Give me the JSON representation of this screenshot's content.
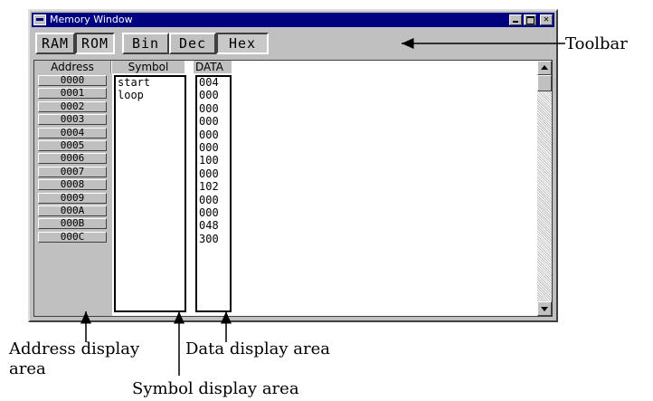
{
  "window": {
    "title": "Memory Window",
    "buttons": [
      "minimize",
      "maximize",
      "close"
    ]
  },
  "toolbar": {
    "buttons": [
      {
        "label": "RAM",
        "pressed": false
      },
      {
        "label": "ROM",
        "pressed": true
      },
      {
        "label": "Bin",
        "pressed": false
      },
      {
        "label": "Dec",
        "pressed": false
      },
      {
        "label": "Hex",
        "pressed": true
      }
    ]
  },
  "columns": {
    "address": "Address",
    "symbol": "Symbol",
    "data": "DATA"
  },
  "rows": [
    {
      "address": "0000",
      "symbol": "start",
      "data": "004"
    },
    {
      "address": "0001",
      "symbol": "loop",
      "data": "000"
    },
    {
      "address": "0002",
      "symbol": "",
      "data": "000"
    },
    {
      "address": "0003",
      "symbol": "",
      "data": "000"
    },
    {
      "address": "0004",
      "symbol": "",
      "data": "000"
    },
    {
      "address": "0005",
      "symbol": "",
      "data": "000"
    },
    {
      "address": "0006",
      "symbol": "",
      "data": "100"
    },
    {
      "address": "0007",
      "symbol": "",
      "data": "000"
    },
    {
      "address": "0008",
      "symbol": "",
      "data": "102"
    },
    {
      "address": "0009",
      "symbol": "",
      "data": "000"
    },
    {
      "address": "000A",
      "symbol": "",
      "data": "000"
    },
    {
      "address": "000B",
      "symbol": "",
      "data": "048"
    },
    {
      "address": "000C",
      "symbol": "",
      "data": "300"
    }
  ],
  "annotations": {
    "toolbar": "Toolbar",
    "address_area_line1": "Address display",
    "address_area_line2": "area",
    "data_area": "Data display area",
    "symbol_area": "Symbol display area"
  }
}
